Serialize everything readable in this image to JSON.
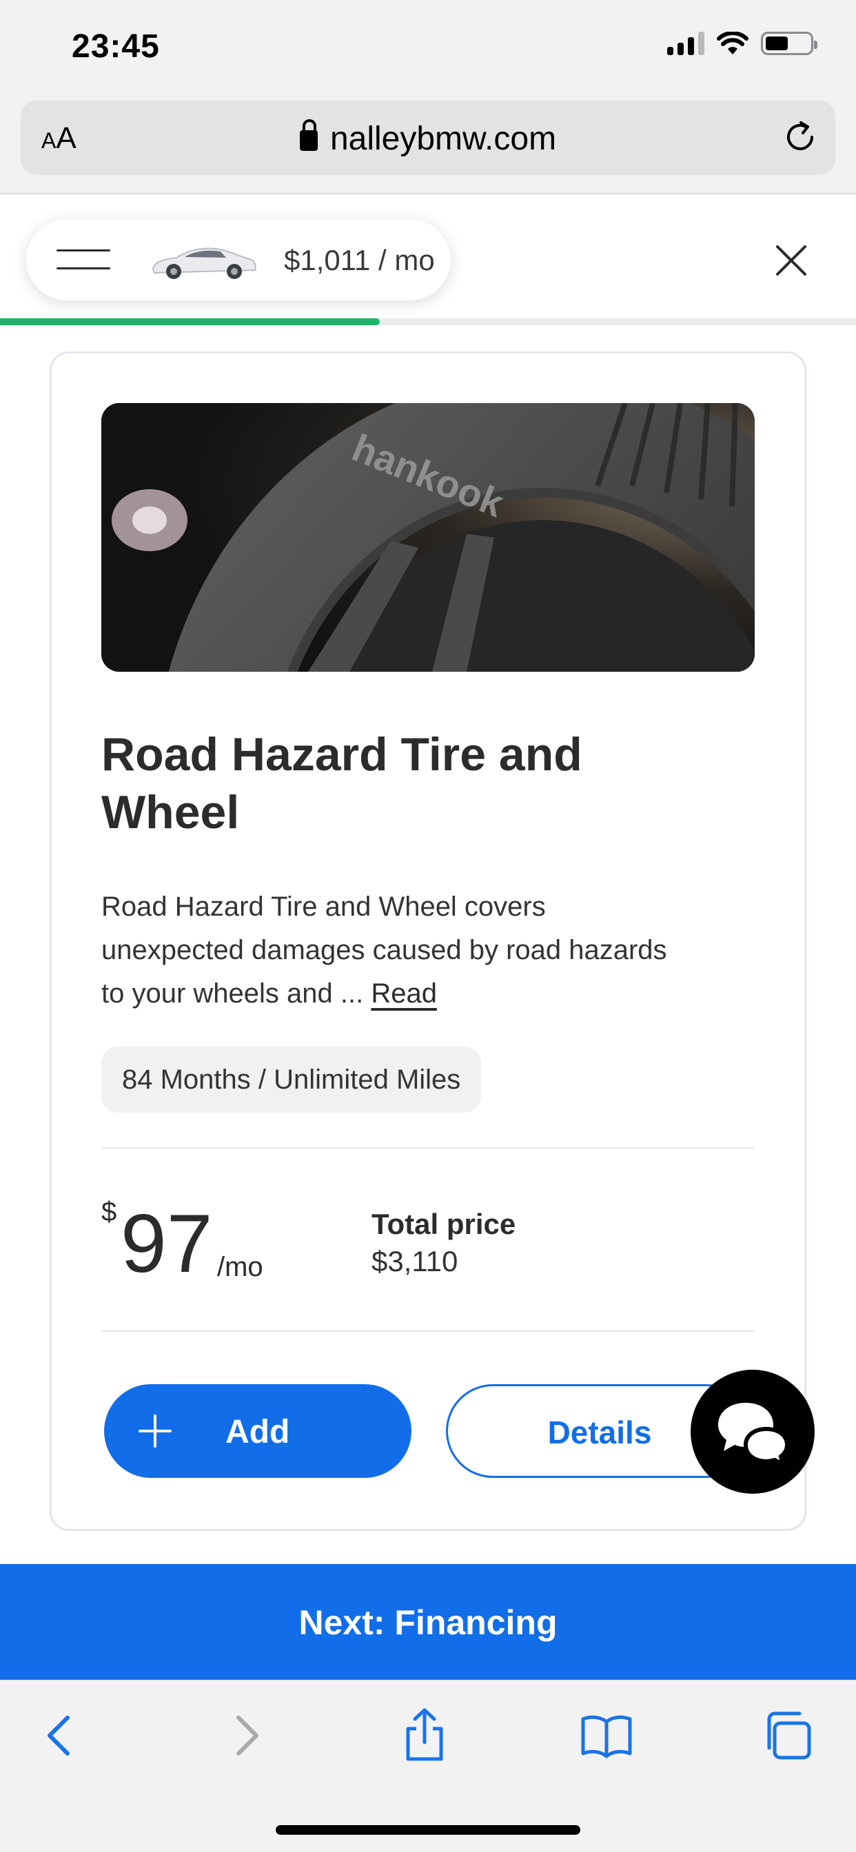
{
  "status_bar": {
    "time": "23:45"
  },
  "browser": {
    "text_size_label_small": "A",
    "text_size_label_large": "A",
    "url": "nalleybmw.com"
  },
  "header": {
    "monthly_total": "$1,011 / mo",
    "progress_fraction": 0.444
  },
  "product": {
    "title": "Road Hazard Tire and Wheel",
    "description": "Road Hazard Tire and Wheel covers unexpected damages caused by road hazards to your wheels and ...",
    "read_more_label": "Read",
    "term": "84 Months / Unlimited Miles",
    "currency_symbol": "$",
    "monthly_price": "97",
    "price_period": "/mo",
    "total_price_label": "Total price",
    "total_price_value": "$3,110",
    "add_button_label": "Add",
    "details_button_label": "Details"
  },
  "next_step": {
    "label": "Next: Financing"
  },
  "colors": {
    "primary": "#116ee8",
    "progress": "#21b36a",
    "chat_fab": "#000000"
  },
  "toolbar": {
    "icons": [
      "back-icon",
      "forward-icon",
      "share-icon",
      "bookmarks-icon",
      "tabs-icon"
    ]
  }
}
